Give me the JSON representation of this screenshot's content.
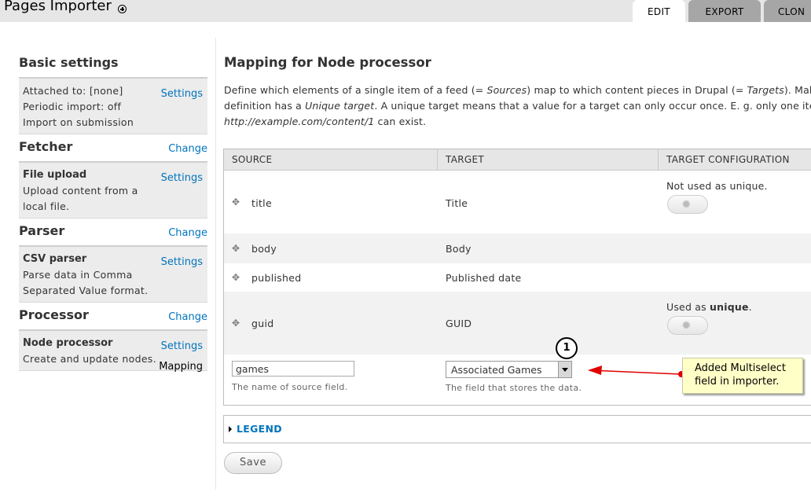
{
  "header": {
    "title": "Pages Importer",
    "tabs": [
      {
        "label": "EDIT",
        "active": true
      },
      {
        "label": "EXPORT"
      },
      {
        "label": "CLON"
      }
    ]
  },
  "sidebar": {
    "basic": {
      "title": "Basic settings",
      "lines": [
        "Attached to: [none]",
        "Periodic import: off",
        "Import on submission"
      ],
      "link": "Settings"
    },
    "fetcher": {
      "title": "Fetcher",
      "change": "Change",
      "name": "File upload",
      "desc": [
        "Upload content from a",
        "local file."
      ],
      "link": "Settings"
    },
    "parser": {
      "title": "Parser",
      "change": "Change",
      "name": "CSV parser",
      "desc": [
        "Parse data in Comma",
        "Separated Value format."
      ],
      "link": "Settings"
    },
    "processor": {
      "title": "Processor",
      "change": "Change",
      "name": "Node processor",
      "desc": [
        "Create and update nodes."
      ],
      "link": "Settings",
      "link2": "Mapping"
    }
  },
  "main": {
    "heading": "Mapping for Node processor",
    "intro": {
      "l1a": "Define which elements of a single item of a feed (= ",
      "l1b": "Sources",
      "l1c": ") map to which content pieces in Drupal (= ",
      "l1d": "Targets",
      "l1e": "). Make",
      "l2a": "definition has a ",
      "l2b": "Unique target",
      "l2c": ". A unique target means that a value for a target can only occur once. E. g. only one item",
      "l3a": "http://example.com/content/1",
      "l3b": " can exist."
    },
    "table": {
      "headers": [
        "SOURCE",
        "TARGET",
        "TARGET CONFIGURATION"
      ],
      "rows": [
        {
          "source": "title",
          "target": "Title",
          "config": "Not used as unique."
        },
        {
          "source": "body",
          "target": "Body",
          "config": ""
        },
        {
          "source": "published",
          "target": "Published date",
          "config": ""
        },
        {
          "source": "guid",
          "target": "GUID",
          "config_pre": "Used as ",
          "config_bold": "unique",
          "config_post": "."
        }
      ],
      "new_row": {
        "source_value": "games",
        "source_desc": "The name of source field.",
        "target_value": "Associated Games",
        "target_desc": "The field that stores the data."
      }
    },
    "legend": "LEGEND",
    "save": "Save"
  },
  "annotation": {
    "number": "1",
    "text_l1": "Added Multiselect",
    "text_l2": "field in importer.",
    "color": "#e00000"
  },
  "colors": {
    "link": "#0074bd",
    "tab_bg": "#a6a6a6",
    "callout_bg": "#ffffc8"
  }
}
